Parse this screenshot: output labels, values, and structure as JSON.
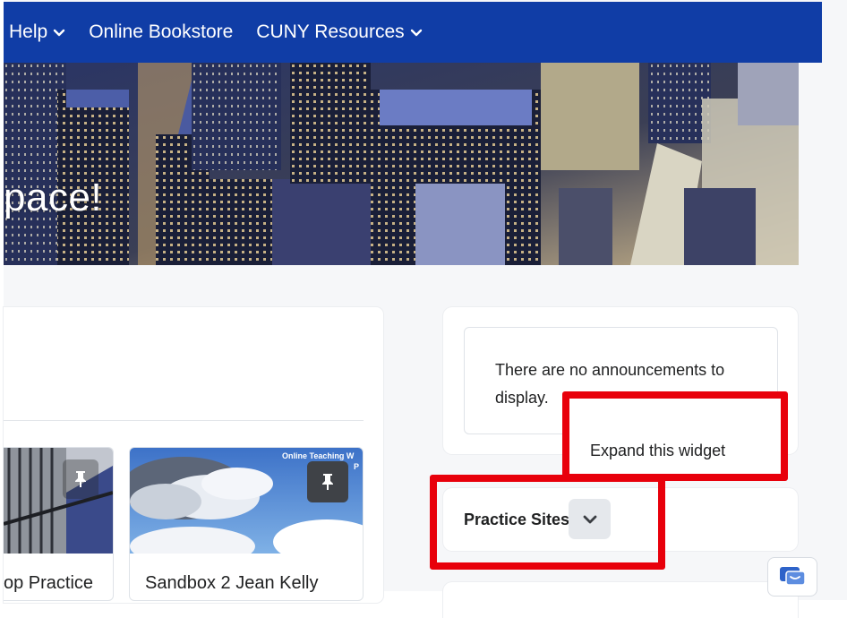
{
  "nav": {
    "items": [
      {
        "label": "Help",
        "has_dropdown": true
      },
      {
        "label": "Online Bookstore",
        "has_dropdown": false
      },
      {
        "label": "CUNY Resources",
        "has_dropdown": true
      }
    ],
    "background_color": "#103da6"
  },
  "hero": {
    "title_fragment": "pace!",
    "image": "city-skyline-at-night"
  },
  "courses": [
    {
      "title": "op Practice",
      "image": "building-with-railings",
      "pin_icon": "pin-icon"
    },
    {
      "title": "Sandbox 2 Jean Kelly",
      "image": "sky-with-clouds",
      "watermark": "Online Teaching W",
      "watermark_line2": "P",
      "pin_icon": "pin-icon"
    }
  ],
  "announcements": {
    "empty_text": "There are no announcements to display."
  },
  "tooltip": {
    "label": "Expand this widget"
  },
  "practice_sites": {
    "label": "Practice Sites",
    "toggle_icon": "chevron-down-icon"
  },
  "chat": {
    "icon": "chat-icon"
  },
  "colors": {
    "highlight": "#e8000b",
    "accent": "#103da6"
  }
}
